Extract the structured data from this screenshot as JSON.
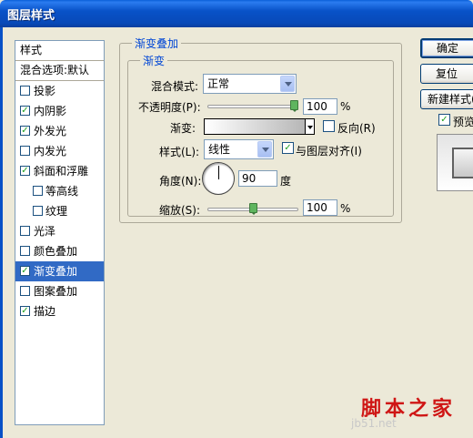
{
  "window": {
    "title": "图层样式"
  },
  "sidebar": {
    "header": "样式",
    "blend_options": "混合选项:默认",
    "items": [
      {
        "label": "投影",
        "checked": false,
        "sub": false
      },
      {
        "label": "内阴影",
        "checked": true,
        "sub": false
      },
      {
        "label": "外发光",
        "checked": true,
        "sub": false
      },
      {
        "label": "内发光",
        "checked": false,
        "sub": false
      },
      {
        "label": "斜面和浮雕",
        "checked": true,
        "sub": false
      },
      {
        "label": "等高线",
        "checked": false,
        "sub": true
      },
      {
        "label": "纹理",
        "checked": false,
        "sub": true
      },
      {
        "label": "光泽",
        "checked": false,
        "sub": false
      },
      {
        "label": "颜色叠加",
        "checked": false,
        "sub": false
      },
      {
        "label": "渐变叠加",
        "checked": true,
        "sub": false,
        "selected": true
      },
      {
        "label": "图案叠加",
        "checked": false,
        "sub": false
      },
      {
        "label": "描边",
        "checked": true,
        "sub": false
      }
    ]
  },
  "panel": {
    "group_title": "渐变叠加",
    "subgroup_title": "渐变",
    "blend_mode_label": "混合模式:",
    "blend_mode_value": "正常",
    "opacity_label": "不透明度(P):",
    "opacity_value": "100",
    "opacity_level": 1.0,
    "opacity_unit": "%",
    "gradient_label": "渐变:",
    "reverse_label": "反向(R)",
    "reverse_checked": false,
    "style_label": "样式(L):",
    "style_value": "线性",
    "align_label": "与图层对齐(I)",
    "align_checked": true,
    "angle_label": "角度(N):",
    "angle_value": "90",
    "angle_unit": "度",
    "scale_label": "缩放(S):",
    "scale_value": "100",
    "scale_level": 0.5,
    "scale_unit": "%"
  },
  "buttons": {
    "ok": "确定",
    "reset": "复位",
    "new_style": "新建样式(W)...",
    "preview_label": "预览(V)",
    "preview_checked": true
  },
  "watermark": {
    "text": "脚本之家",
    "url": "jb51.net"
  }
}
